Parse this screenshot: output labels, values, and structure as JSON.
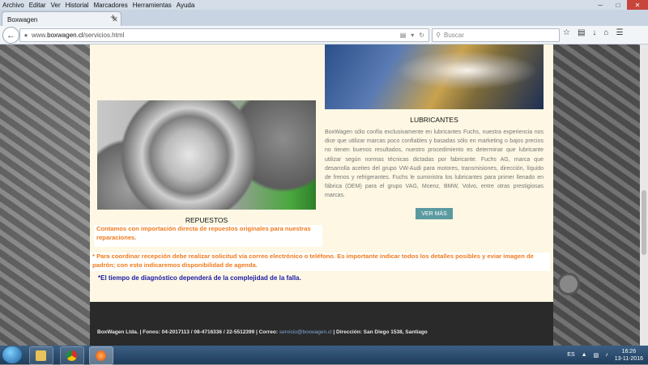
{
  "browser": {
    "menu": [
      "Archivo",
      "Editar",
      "Ver",
      "Historial",
      "Marcadores",
      "Herramientas",
      "Ayuda"
    ],
    "tab_title": "Boxwagen",
    "url_prefix": "www.",
    "url_domain": "boxwagen.cl",
    "url_path": "/servicios.html",
    "search_placeholder": "Buscar",
    "new_tab_symbol": "+"
  },
  "page": {
    "lubricantes": {
      "title": "LUBRICANTES",
      "text": "BoxWagen sólo confía exclusivamente en lubricantes Fuchs, nuestra experiencia nos dice que utilizar marcas poco confiables y basadas sólo en marketing o bajos precios no tienen buenos resultados, nuestro procedimiento es determinar que lubricante utilizar según normas técnicas dictadas por fabricante. Fuchs AG, marca que desarrolla aceites del grupo VW-Audi para motores, transmisiones, dirección, líquido de frenos y refrigerantes. Fuchs le suministra los lubricantes para primer llenado en fábrica (OEM) para el grupo VAG, Moenz, BMW, Volvo, entre otras prestigiosas marcas.",
      "button": "VER MÁS"
    },
    "repuestos": {
      "title": "REPUESTOS"
    },
    "notice_import": "Contamos con importación directa de repuestos originales para nuestras reparaciones.",
    "notice_request": "* Para coordinar recepción debe realizar solicitud vía correo electrónico o teléfono. Es importante indicar todos los detalles posibles y eviar imagen de padrón; con esto indicaremos disponibilidad de agenda.",
    "notice_diagnostic": "*El tiempo de diagnóstico dependerá de la complejidad de la falla.",
    "footer": {
      "company": "BoxWagen Ltda. | Fonos: 04-2017113 / 08-4716336 / 22-5512399 | Correo: ",
      "email": "servicio@boxwagen.cl",
      "address": " | Dirección: San Diego 1538, Santiago"
    }
  },
  "taskbar": {
    "language": "ES",
    "time": "16:26",
    "date": "13-11-2016"
  },
  "colors": {
    "accent_orange": "#f07a1b",
    "accent_blue": "#1a1aa6",
    "button_teal": "#5b9aa0"
  }
}
